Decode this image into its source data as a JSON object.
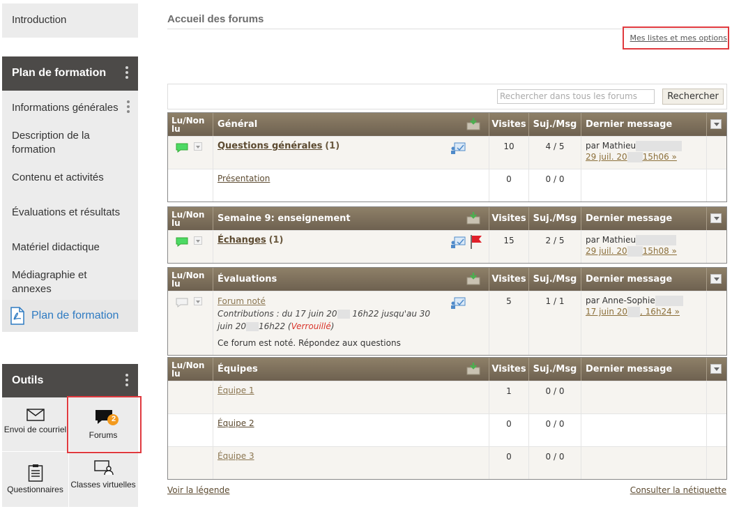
{
  "sidebar": {
    "intro_label": "Introduction",
    "plan_header": "Plan de formation",
    "plan_items": [
      "Informations générales",
      "Description de la formation",
      "Contenu et activités",
      "Évaluations et résultats",
      "Matériel didactique",
      "Médiagraphie et annexes"
    ],
    "plan_pdf_label": "Plan de formation",
    "tools_header": "Outils",
    "tools": {
      "email": "Envoi de courriel",
      "forums": "Forums",
      "forums_badge": "2",
      "questionnaires": "Questionnaires",
      "virtual_classes": "Classes virtuelles"
    }
  },
  "main": {
    "title": "Accueil des forums",
    "my_lists_link": "Mes listes et mes options",
    "search_placeholder": "Rechercher dans tous les forums",
    "search_button": "Rechercher",
    "columns": {
      "read": "Lu/Non lu",
      "visits": "Visites",
      "topics": "Suj./Msg",
      "last": "Dernier message"
    },
    "forums": [
      {
        "name": "Général",
        "rows": [
          {
            "title": "Questions générales",
            "count": "(1)",
            "visits": "10",
            "topics": "4 / 5",
            "last_by": "par Mathieu",
            "last_date_a": "29 juil. 20",
            "last_date_b": "15h06 »"
          },
          {
            "title": "Présentation",
            "visits": "0",
            "topics": "0 / 0"
          }
        ]
      },
      {
        "name": "Semaine 9: enseignement",
        "rows": [
          {
            "title": "Échanges",
            "count": "(1)",
            "visits": "15",
            "topics": "2 / 5",
            "last_by": "par Mathieu",
            "last_date_a": "29 juil. 20",
            "last_date_b": "15h08 »"
          }
        ]
      },
      {
        "name": "Évaluations",
        "rows": [
          {
            "title": "Forum noté",
            "contrib_a": "Contributions : du 17 juin 20",
            "contrib_b": "16h22 jusqu'au 30",
            "contrib_c": "juin 20",
            "contrib_d": "16h22 (",
            "locked": "Verrouillé",
            "contrib_e": ")",
            "note": "Ce forum est noté. Répondez aux questions",
            "visits": "5",
            "topics": "1 / 1",
            "last_by": "par Anne-Sophie",
            "last_date_a": "17 juin 20",
            "last_date_b": ", 16h24 »"
          }
        ]
      },
      {
        "name": "Équipes",
        "rows": [
          {
            "title": "Équipe 1",
            "visits": "1",
            "topics": "0 / 0"
          },
          {
            "title": "Équipe 2",
            "visits": "0",
            "topics": "0 / 0"
          },
          {
            "title": "Équipe 3",
            "visits": "0",
            "topics": "0 / 0"
          }
        ]
      }
    ],
    "legend_link": "Voir la légende",
    "netiquette_link": "Consulter la nétiquette"
  },
  "colors": {
    "header_brown": "#7b6d58",
    "highlight_red": "#e0393e",
    "pdf_blue": "#2f7bc2",
    "badge_orange": "#f39a1e"
  }
}
